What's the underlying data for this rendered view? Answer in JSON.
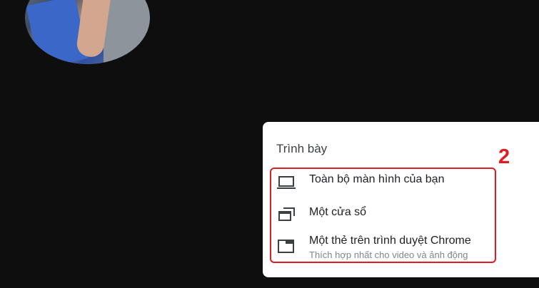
{
  "panel": {
    "title": "Trình bày",
    "marker": "2",
    "options": [
      {
        "icon": "laptop-icon",
        "label": "Toàn bộ màn hình của bạn"
      },
      {
        "icon": "window-icon",
        "label": "Một cửa sổ"
      },
      {
        "icon": "browser-tab-icon",
        "label": "Một thẻ trên trình duyệt Chrome",
        "sublabel": "Thích hợp nhất cho video và ảnh động"
      }
    ]
  },
  "colors": {
    "background": "#0e0e0e",
    "panel": "#ffffff",
    "annotation": "#e01c24",
    "text": "#202124",
    "subtext": "#80868b"
  }
}
